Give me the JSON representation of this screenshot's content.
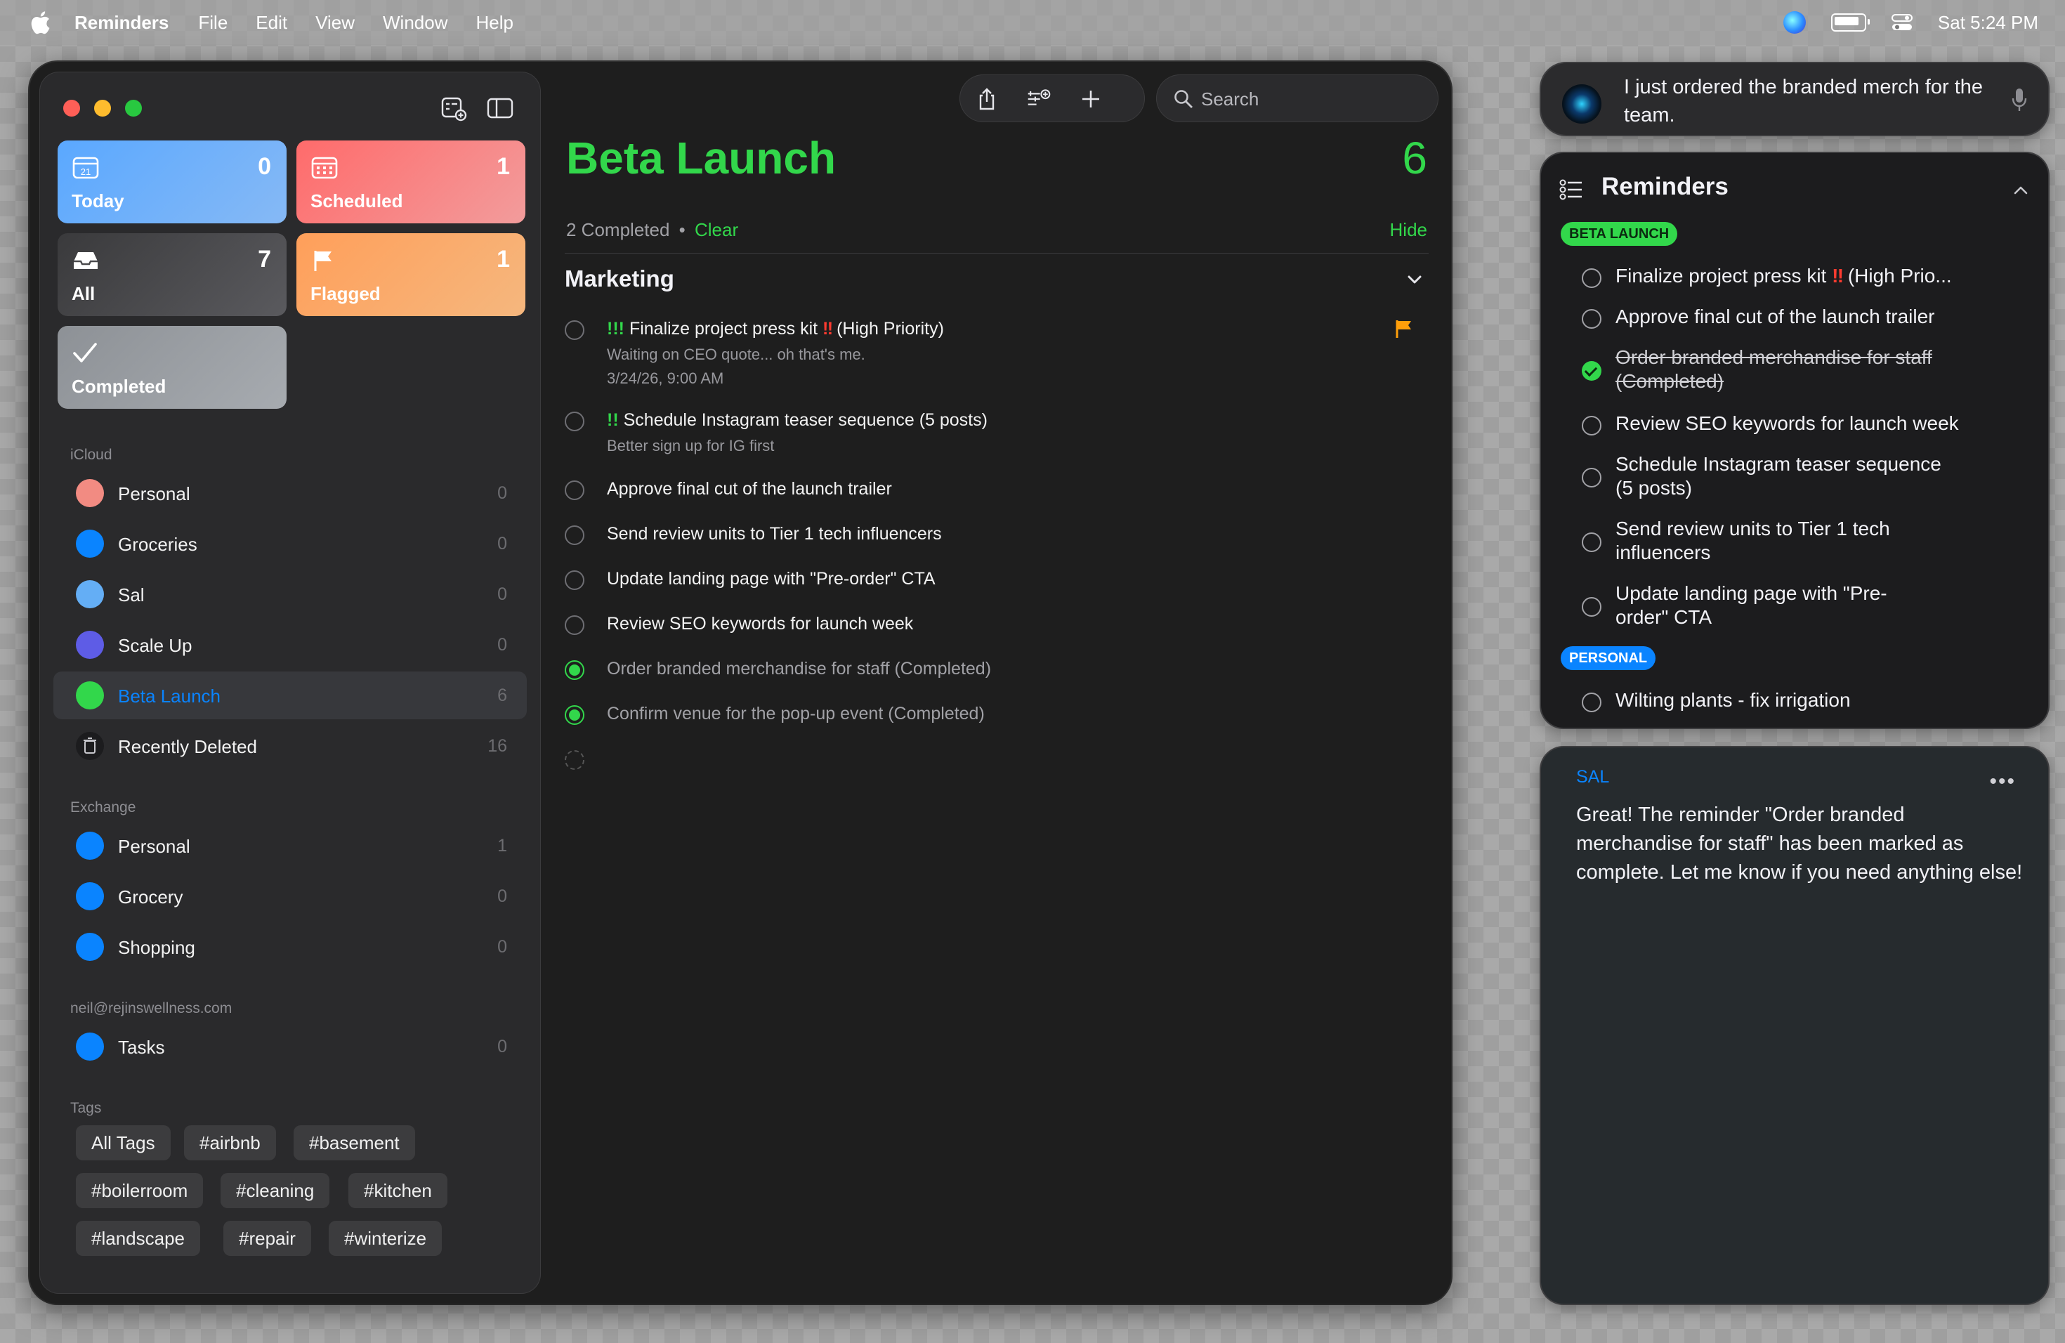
{
  "menubar": {
    "app_name": "Reminders",
    "items": [
      "File",
      "Edit",
      "View",
      "Window",
      "Help"
    ],
    "clock": "Sat 5:24 PM"
  },
  "smart_lists": {
    "today": {
      "label": "Today",
      "count": "0",
      "icon": "calendar-icon",
      "date": "21"
    },
    "scheduled": {
      "label": "Scheduled",
      "count": "1",
      "icon": "calendar-grid-icon"
    },
    "all": {
      "label": "All",
      "count": "7",
      "icon": "tray-icon"
    },
    "flagged": {
      "label": "Flagged",
      "count": "1",
      "icon": "flag-icon"
    },
    "completed": {
      "label": "Completed",
      "icon": "checkmark-icon"
    }
  },
  "sidebar": {
    "icloud_label": "iCloud",
    "icloud_lists": [
      {
        "name": "Personal",
        "count": "0",
        "color": "#f28b82"
      },
      {
        "name": "Groceries",
        "count": "0",
        "color": "#0a84ff"
      },
      {
        "name": "Sal",
        "count": "0",
        "color": "#64aef5"
      },
      {
        "name": "Scale Up",
        "count": "0",
        "color": "#5e5ce6"
      },
      {
        "name": "Beta Launch",
        "count": "6",
        "color": "#32d74b"
      },
      {
        "name": "Recently Deleted",
        "count": "16",
        "color": "#1c1c1e"
      }
    ],
    "exchange_label": "Exchange",
    "exchange_lists": [
      {
        "name": "Personal",
        "count": "1",
        "color": "#0a84ff"
      },
      {
        "name": "Grocery",
        "count": "0",
        "color": "#0a84ff"
      },
      {
        "name": "Shopping",
        "count": "0",
        "color": "#0a84ff"
      }
    ],
    "account_label": "neil@rejinswellness.com",
    "account_lists": [
      {
        "name": "Tasks",
        "count": "0",
        "color": "#0a84ff"
      }
    ],
    "tags_label": "Tags",
    "tags": [
      "All Tags",
      "#airbnb",
      "#basement",
      "#boilerroom",
      "#cleaning",
      "#kitchen",
      "#landscape",
      "#repair",
      "#winterize"
    ]
  },
  "main": {
    "title": "Beta Launch",
    "count": "6",
    "completed_text": "2 Completed",
    "separator": "•",
    "clear_label": "Clear",
    "hide_label": "Hide",
    "search_placeholder": "Search",
    "group_title": "Marketing",
    "accent": "#32d74b",
    "tasks": [
      {
        "priority": "!!!",
        "title": "Finalize project press kit",
        "bang": "‼",
        "suffix": "(High Priority)",
        "notes": "Waiting on CEO quote... oh that's me.",
        "date": "3/24/26, 9:00 AM",
        "flagged": true
      },
      {
        "priority": "!!",
        "title": "Schedule Instagram teaser sequence (5 posts)",
        "notes": "Better sign up for IG first"
      },
      {
        "title": "Approve final cut of the launch trailer"
      },
      {
        "title": "Send review units to Tier 1 tech influencers"
      },
      {
        "title": "Update landing page with \"Pre-order\" CTA"
      },
      {
        "title": "Review SEO keywords for launch week"
      },
      {
        "title": "Order branded merchandise for staff (Completed)",
        "completed": true
      },
      {
        "title": "Confirm venue for the pop-up event (Completed)",
        "completed": true
      }
    ]
  },
  "siri": {
    "prompt": "I just ordered the branded merch for the team."
  },
  "reminders_panel": {
    "title": "Reminders",
    "beta_badge": "BETA LAUNCH",
    "beta_items": [
      {
        "pre": "Finalize project press kit",
        "bang": "‼",
        "post": "(High Prio..."
      },
      {
        "text": "Approve final cut of the launch trailer"
      },
      {
        "text": "Order branded merchandise for staff (Completed)",
        "completed": true
      },
      {
        "text": "Review SEO keywords for launch week"
      },
      {
        "text": "Schedule Instagram teaser sequence (5 posts)"
      },
      {
        "text": "Send review units to Tier 1 tech influencers"
      },
      {
        "text": "Update landing page with \"Pre-order\" CTA"
      }
    ],
    "personal_badge": "PERSONAL",
    "personal_items": [
      {
        "text": "Wilting plants - fix irrigation"
      }
    ]
  },
  "chat": {
    "label": "SAL",
    "more": "•••",
    "message": "Great! The reminder \"Order branded merchandise for staff\" has been marked as complete. Let me know if you need anything else!"
  }
}
